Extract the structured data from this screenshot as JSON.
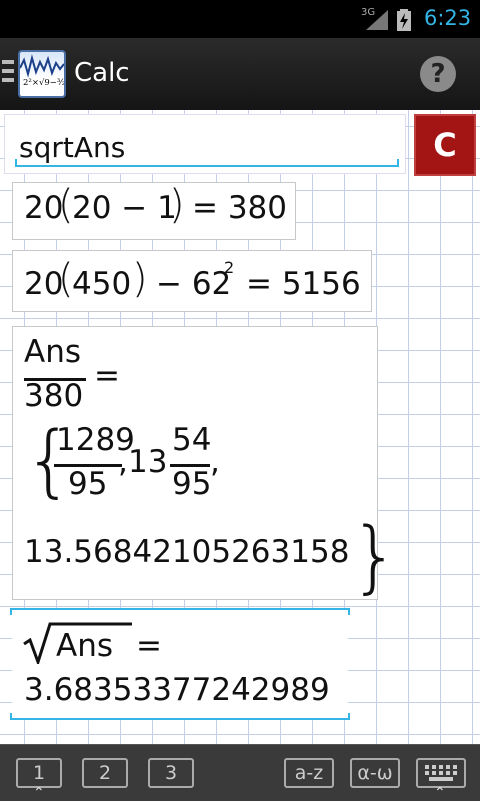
{
  "status": {
    "network": "3G",
    "time": "6:23"
  },
  "app": {
    "title": "Calc"
  },
  "input": {
    "value": "sqrtAns",
    "clear_label": "C"
  },
  "history": [
    {
      "a": "20",
      "b": "20 − 1",
      "c": "= 380"
    },
    {
      "a": "20",
      "b": "450",
      "c": "− 62",
      "d": "2",
      "e": "= 5156"
    },
    {
      "num": "Ans",
      "den": "380",
      "eq": "=",
      "f1num": "1289",
      "f1den": "95",
      "comma": ",",
      "whole": "13",
      "f2num": "54",
      "f2den": "95",
      "sep": ",",
      "dec": "13.5684210526315​8"
    },
    {
      "radicand": "Ans",
      "eq": "=",
      "value": "3.68353377242989"
    }
  ],
  "keyboard": {
    "keys": [
      "1",
      "2",
      "3",
      "a-z",
      "α-ω"
    ]
  }
}
